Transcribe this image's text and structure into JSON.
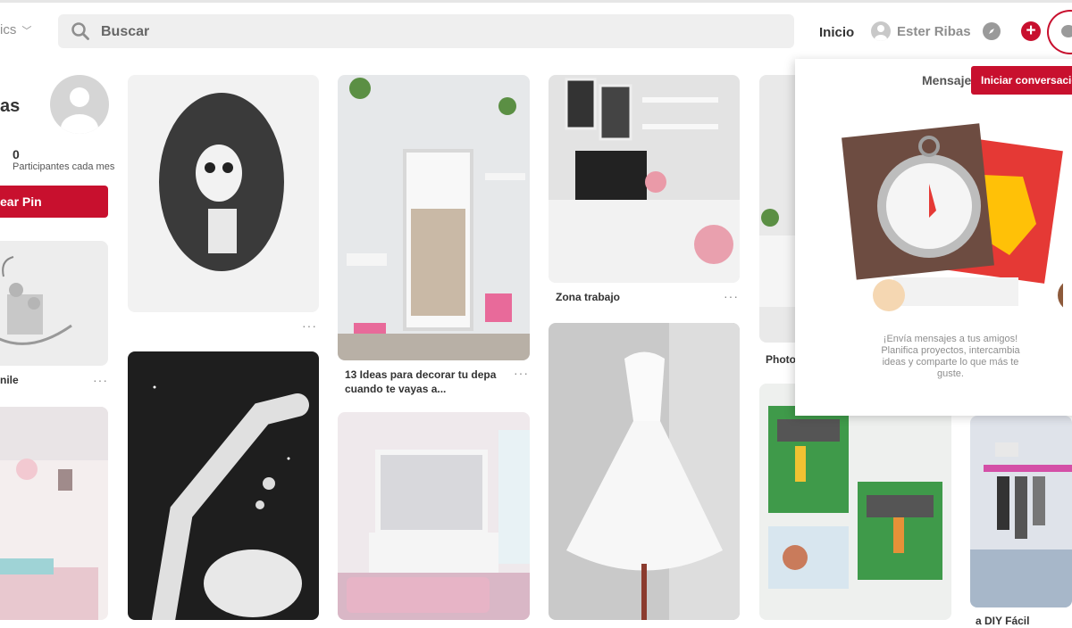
{
  "header": {
    "category_text": "ics",
    "search_placeholder": "Buscar",
    "home_label": "Inicio",
    "user_name": "Ester Ribas"
  },
  "profile": {
    "name_partial": "as",
    "monthly_participants_value": "0",
    "monthly_participants_label": "Participantes cada mes",
    "create_pin_label": "ear Pin"
  },
  "pins": {
    "pin1_title": "nile",
    "pin2_title_line1": "13 Ideas para decorar tu depa",
    "pin2_title_line2": "cuando te vayas a...",
    "pin3_title": "Zona trabajo",
    "pin4_title": "Photo",
    "pin5_title": "a DIY Fácil",
    "more_label": "···"
  },
  "messages_panel": {
    "title": "Mensaje",
    "start_conversation_label": "Iniciar conversación",
    "text_line1": "¡Envía mensajes a tus amigos!",
    "text_line2": "Planifica proyectos, intercambia",
    "text_line3": "ideas y comparte lo que más te",
    "text_line4": "guste."
  },
  "colors": {
    "brand_red": "#c8102e",
    "search_bg": "#efefef"
  }
}
